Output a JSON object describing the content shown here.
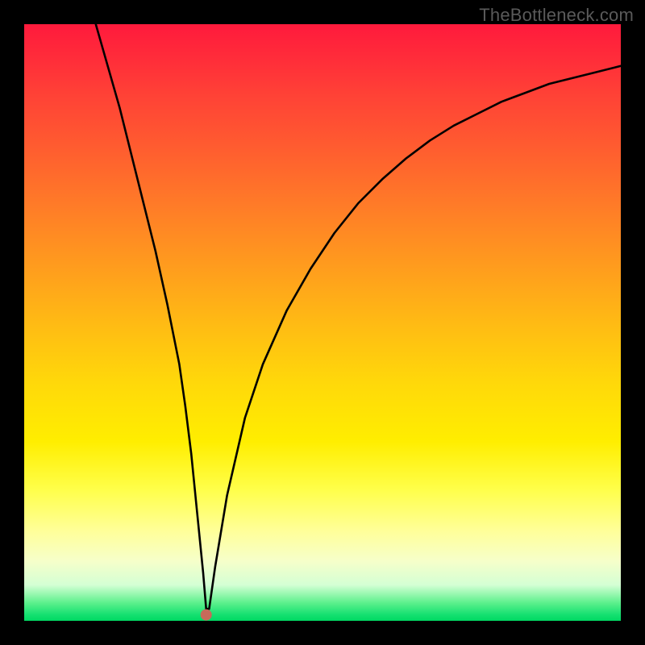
{
  "watermark": "TheBottleneck.com",
  "chart_data": {
    "type": "line",
    "title": "",
    "xlabel": "",
    "ylabel": "",
    "xlim": [
      0,
      100
    ],
    "ylim": [
      0,
      100
    ],
    "series": [
      {
        "name": "curve",
        "x": [
          12,
          14,
          16,
          18,
          20,
          22,
          24,
          26,
          27,
          28,
          29,
          30,
          30.5,
          31,
          32,
          34,
          37,
          40,
          44,
          48,
          52,
          56,
          60,
          64,
          68,
          72,
          76,
          80,
          84,
          88,
          92,
          96,
          100
        ],
        "y": [
          100,
          93,
          86,
          78,
          70,
          62,
          53,
          43,
          36,
          28,
          18,
          8,
          2,
          2,
          9,
          21,
          34,
          43,
          52,
          59,
          65,
          70,
          74,
          77.5,
          80.5,
          83,
          85,
          87,
          88.5,
          90,
          91,
          92,
          93
        ]
      }
    ],
    "marker": {
      "x": 30.5,
      "y": 1
    },
    "background_gradient": {
      "top": "#ff1a3c",
      "mid": "#ffee00",
      "bottom": "#00d862"
    }
  }
}
